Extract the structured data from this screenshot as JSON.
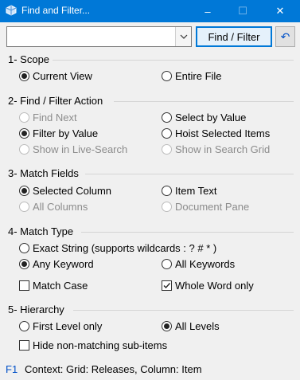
{
  "window": {
    "title": "Find and Filter...",
    "controls": {
      "minimize": "–",
      "maximize": "☐",
      "close": "✕"
    }
  },
  "toolbar": {
    "search_value": "",
    "find_filter_label": "Find / Filter",
    "undo_icon": "↶"
  },
  "sections": {
    "scope": {
      "title": "1- Scope",
      "current_view": "Current View",
      "entire_file": "Entire File"
    },
    "action": {
      "title": "2- Find / Filter Action",
      "find_next": "Find Next",
      "select_by_value": "Select by Value",
      "filter_by_value": "Filter by Value",
      "hoist_selected_items": "Hoist Selected Items",
      "show_in_live_search": "Show in Live-Search",
      "show_in_search_grid": "Show in Search Grid"
    },
    "match_fields": {
      "title": "3- Match Fields",
      "selected_column": "Selected Column",
      "item_text": "Item Text",
      "all_columns": "All Columns",
      "document_pane": "Document Pane"
    },
    "match_type": {
      "title": "4- Match Type",
      "exact_string": "Exact String (supports wildcards : ?  #  * )",
      "any_keyword": "Any Keyword",
      "all_keywords": "All Keywords",
      "match_case": "Match Case",
      "whole_word_only": "Whole Word only"
    },
    "hierarchy": {
      "title": "5- Hierarchy",
      "first_level_only": "First Level only",
      "all_levels": "All Levels",
      "hide_non_matching": "Hide non-matching sub-items"
    }
  },
  "status": {
    "key": "F1",
    "context": "Context: Grid: Releases, Column: Item"
  }
}
